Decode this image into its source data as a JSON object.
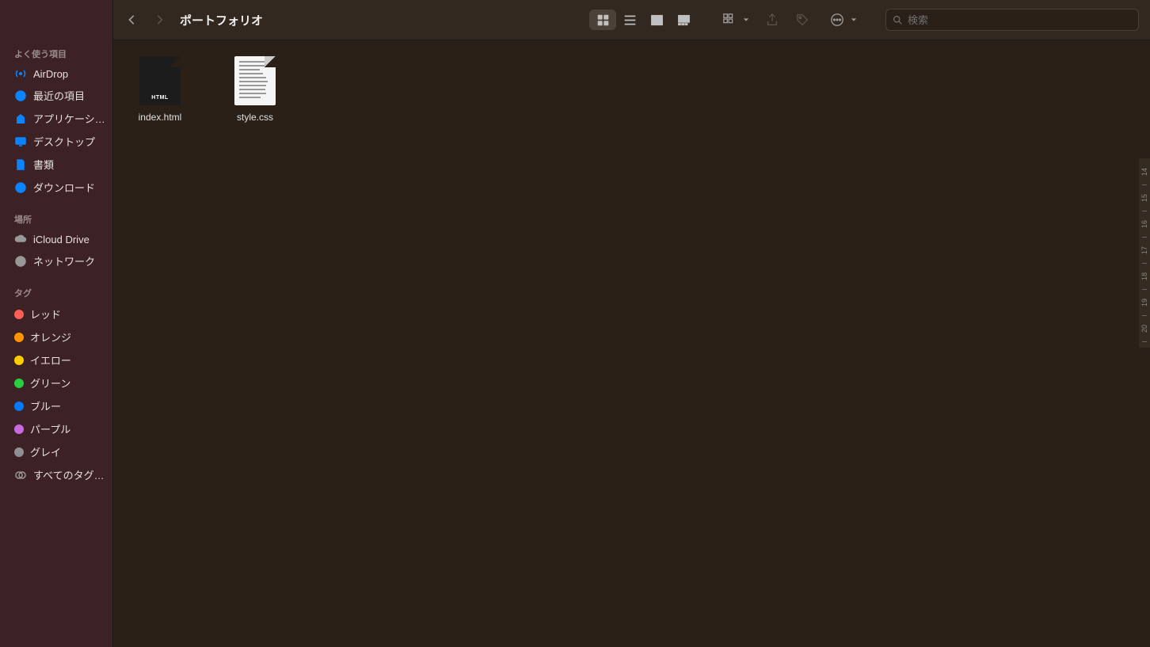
{
  "window": {
    "title": "ポートフォリオ"
  },
  "search": {
    "placeholder": "検索"
  },
  "sidebar": {
    "sections": [
      {
        "title": "よく使う項目",
        "items": [
          {
            "label": "AirDrop",
            "icon": "airdrop"
          },
          {
            "label": "最近の項目",
            "icon": "recent"
          },
          {
            "label": "アプリケーシ…",
            "icon": "applications"
          },
          {
            "label": "デスクトップ",
            "icon": "desktop"
          },
          {
            "label": "書類",
            "icon": "documents"
          },
          {
            "label": "ダウンロード",
            "icon": "downloads"
          }
        ]
      },
      {
        "title": "場所",
        "items": [
          {
            "label": "iCloud Drive",
            "icon": "icloud"
          },
          {
            "label": "ネットワーク",
            "icon": "network"
          }
        ]
      },
      {
        "title": "タグ",
        "items": [
          {
            "label": "レッド",
            "color": "#ff5f56"
          },
          {
            "label": "オレンジ",
            "color": "#ff9500"
          },
          {
            "label": "イエロー",
            "color": "#ffcc00"
          },
          {
            "label": "グリーン",
            "color": "#28cd41"
          },
          {
            "label": "ブルー",
            "color": "#007aff"
          },
          {
            "label": "パープル",
            "color": "#c969e0"
          },
          {
            "label": "グレイ",
            "color": "#8e8e93"
          },
          {
            "label": "すべてのタグ…",
            "alltags": true
          }
        ]
      }
    ]
  },
  "files": [
    {
      "name": "index.html",
      "type": "html"
    },
    {
      "name": "style.css",
      "type": "css"
    }
  ],
  "ruler": [
    "14",
    "15",
    "16",
    "17",
    "18",
    "19",
    "20"
  ]
}
